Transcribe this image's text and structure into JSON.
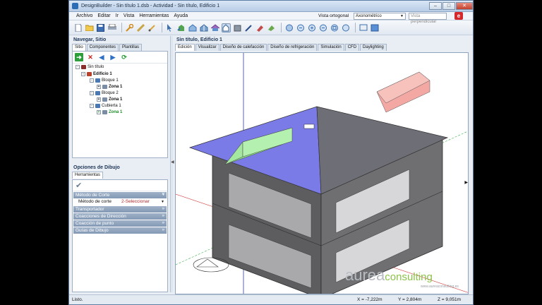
{
  "window": {
    "title": "DesignBuilder - Sin título 1.dsb - Actividad - Sin título, Edificio 1",
    "min": "–",
    "max": "□",
    "close": "✕"
  },
  "menu": {
    "items": [
      "Archivo",
      "Editar",
      "Ir",
      "Vista",
      "Herramientas",
      "Ayuda"
    ],
    "view_label": "Vista ortogonal",
    "view_value": "Axonométrico",
    "perp_placeholder": "Vista perpendicular",
    "help_glyph": "e"
  },
  "toolbar": {
    "icons": [
      "new",
      "open",
      "save",
      "print",
      "wrench",
      "ruler",
      "paint",
      "select",
      "add-block",
      "add-zone",
      "add-partition",
      "add-roof",
      "edit-point",
      "erase",
      "draw",
      "fill",
      "rotate",
      "zoom",
      "zoom-in",
      "zoom-out",
      "zoom-all",
      "pan",
      "screen",
      "render"
    ]
  },
  "left": {
    "nav_title": "Navegar, Sitio",
    "nav_tabs": [
      "Sitio",
      "Componentes",
      "Plantillas"
    ],
    "tree": [
      {
        "label": "Sin título",
        "exp": "-",
        "bold": false,
        "green": false,
        "color": "#8b2c2c"
      },
      {
        "label": "Edificio 1",
        "exp": "-",
        "bold": true,
        "green": false,
        "color": "#b8412c"
      },
      {
        "label": "Bloque 1",
        "exp": "-",
        "bold": false,
        "green": false,
        "color": "#4a78b3"
      },
      {
        "label": "Zona 1",
        "exp": "+",
        "bold": true,
        "green": false,
        "color": "#7a8da4"
      },
      {
        "label": "Bloque 2",
        "exp": "-",
        "bold": false,
        "green": false,
        "color": "#4a78b3"
      },
      {
        "label": "Zona 1",
        "exp": "+",
        "bold": true,
        "green": false,
        "color": "#7a8da4"
      },
      {
        "label": "Cubierta 1",
        "exp": "-",
        "bold": false,
        "green": false,
        "color": "#4a78b3"
      },
      {
        "label": "Zona 1",
        "exp": "+",
        "bold": true,
        "green": true,
        "color": "#7a8da4"
      }
    ],
    "opts_title": "Opciones de Dibujo",
    "opts_tab": "Herramientas",
    "sections": [
      {
        "label": "Método de Corte",
        "chev": "»"
      },
      {
        "label": "Transportador",
        "chev": "»"
      },
      {
        "label": "Coacciones de Dirección",
        "chev": "»"
      },
      {
        "label": "Coacción de punto",
        "chev": "»"
      },
      {
        "label": "Guías de Dibujo",
        "chev": "»"
      }
    ],
    "cut_label": "Método de corte",
    "cut_value": "2-Seleccionar"
  },
  "main": {
    "title": "Sin título, Edificio 1",
    "tabs": [
      "Edición",
      "Visualizar",
      "Diseño de calefacción",
      "Diseño de refrigeración",
      "Simulación",
      "CFD",
      "Daylighting"
    ]
  },
  "status": {
    "ready": "Listo.",
    "x": "X = -7,222m",
    "y": "Y = 2,804m",
    "z": "Z = 9,051m"
  },
  "logo": {
    "word1": "aurea",
    "word2": "consulting",
    "url": "www.aureaconsulting.es"
  }
}
